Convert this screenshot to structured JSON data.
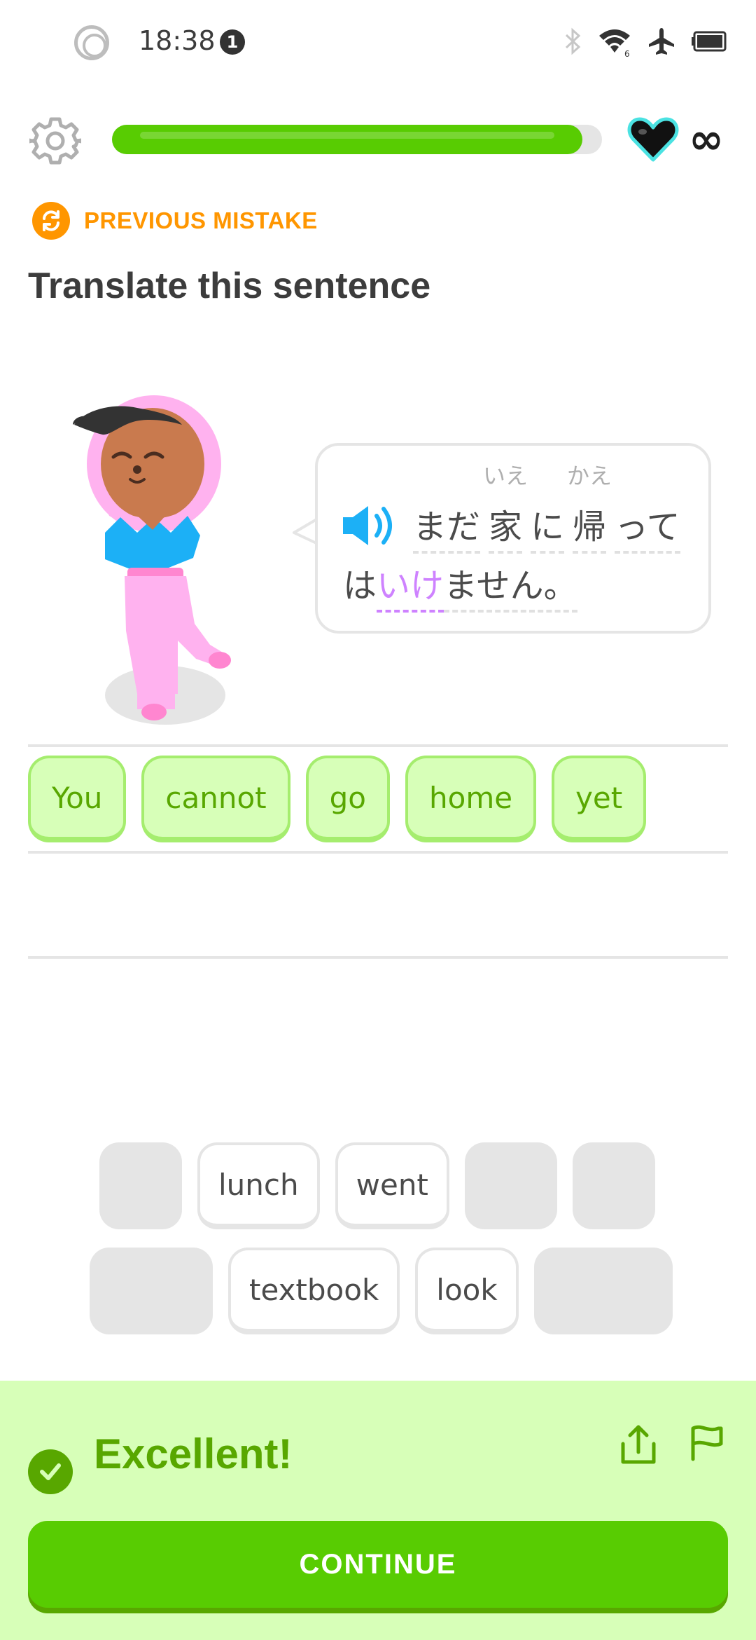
{
  "status_bar": {
    "time": "18:38",
    "notification_count": "1",
    "icons": [
      "bluetooth-icon",
      "wifi-icon",
      "airplane-icon",
      "battery-icon"
    ]
  },
  "header": {
    "progress_fraction": 0.96,
    "hearts": "∞"
  },
  "challenge": {
    "tag": "PREVIOUS MISTAKE",
    "title": "Translate this sentence",
    "sentence_line1": [
      {
        "text": "まだ",
        "ruby": "",
        "style": "dashed"
      },
      {
        "text": "家",
        "ruby": "いえ",
        "style": "dashed"
      },
      {
        "text": "に",
        "ruby": "",
        "style": "dashed"
      },
      {
        "text": "帰",
        "ruby": "かえ",
        "style": "dashed"
      },
      {
        "text": "って",
        "ruby": "",
        "style": "dashed"
      }
    ],
    "sentence_line2": [
      {
        "text": "は",
        "ruby": "",
        "style": "plain"
      },
      {
        "text": "いけ",
        "ruby": "",
        "style": "highlight"
      },
      {
        "text": "ません。",
        "ruby": "",
        "style": "dashed"
      }
    ]
  },
  "answer": [
    "You",
    "cannot",
    "go",
    "home",
    "yet"
  ],
  "word_bank": {
    "row1": [
      {
        "text": "",
        "empty": true,
        "w": 118
      },
      {
        "text": "lunch",
        "empty": false
      },
      {
        "text": "went",
        "empty": false
      },
      {
        "text": "",
        "empty": true,
        "w": 132
      },
      {
        "text": "",
        "empty": true,
        "w": 118
      }
    ],
    "row2": [
      {
        "text": "",
        "empty": true,
        "w": 176
      },
      {
        "text": "textbook",
        "empty": false
      },
      {
        "text": "look",
        "empty": false
      },
      {
        "text": "",
        "empty": true,
        "w": 198
      }
    ]
  },
  "feedback": {
    "message": "Excellent!",
    "continue_label": "CONTINUE"
  },
  "colors": {
    "accent_green": "#58cc02",
    "dark_green": "#58a700",
    "light_green": "#d7ffb8",
    "orange": "#ff9600",
    "purple": "#ce82ff",
    "blue": "#1cb0f6"
  }
}
